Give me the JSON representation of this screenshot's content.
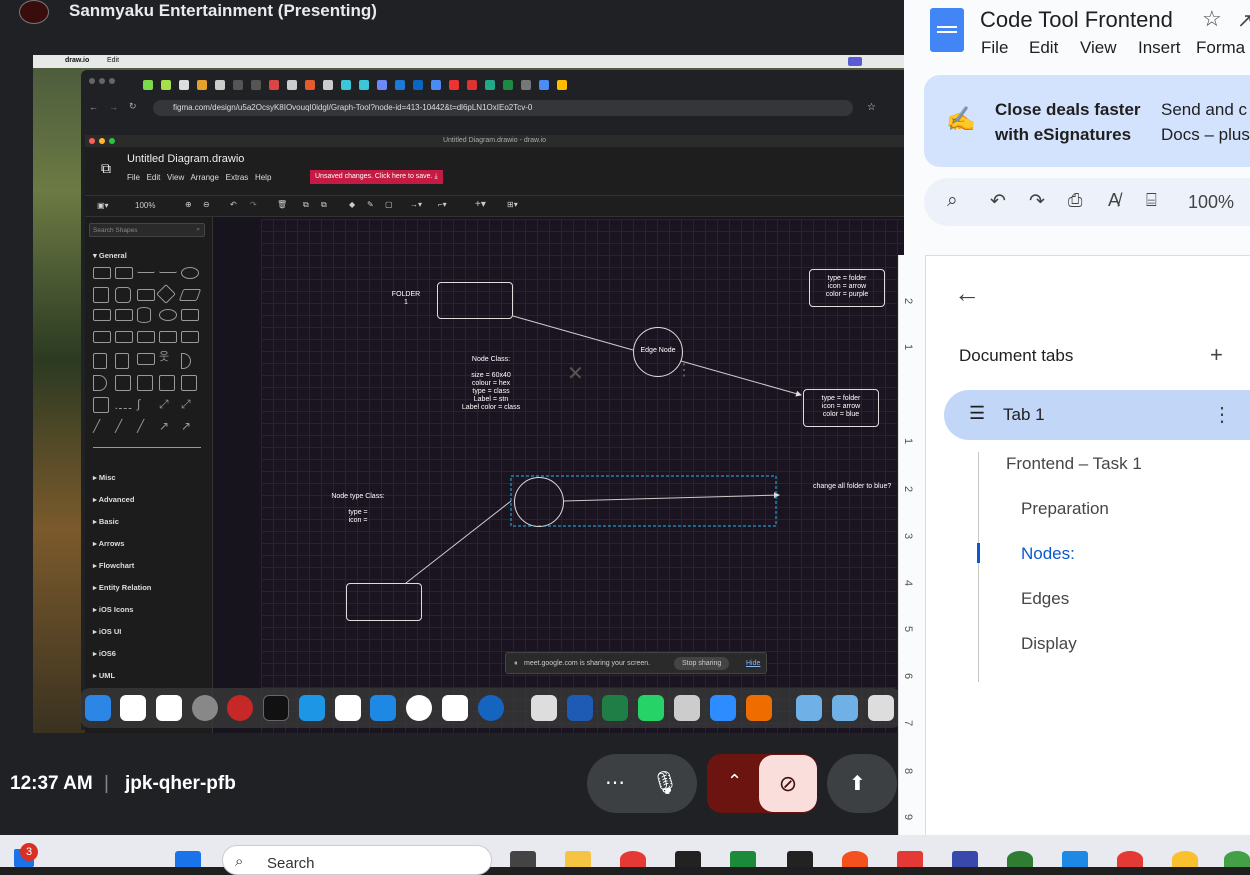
{
  "meet": {
    "presenter": "Sanmyaku Entertainment (Presenting)",
    "time": "12:37 AM",
    "code": "jpk-qher-pfb",
    "separator": "|"
  },
  "mac": {
    "app": "draw.io",
    "menu": "Edit"
  },
  "browser": {
    "url": "figma.com/design/u5a2OcsyK8IOvouqI0idgl/Graph-Tool?node-id=413-10442&t=dl6pLN1OxIEo2Tcv-0"
  },
  "drawio": {
    "window_title": "Untitled Diagram.drawio - draw.io",
    "doc_title": "Untitled Diagram.drawio",
    "menus": [
      "File",
      "Edit",
      "View",
      "Arrange",
      "Extras",
      "Help"
    ],
    "unsaved": "Unsaved changes. Click here to save.",
    "zoom": "100%",
    "search_placeholder": "Search Shapes",
    "sections": [
      "General",
      "Misc",
      "Advanced",
      "Basic",
      "Arrows",
      "Flowchart",
      "Entity Relation",
      "iOS Icons",
      "iOS UI",
      "iOS6",
      "UML"
    ],
    "canvas": {
      "folder_label": "FOLDER\n1",
      "edge_node": "Edge Node",
      "node_class": "Node Class:\n\nsize = 60x40\ncolour = hex\ntype = class\nLabel = stn\nLabel color = class",
      "legend_purple": "type = folder\nicon = arrow\ncolor = purple",
      "legend_blue": "type = folder\nicon = arrow\ncolor = blue",
      "node_type_class": "Node type Class:\n\ntype =\nicon =",
      "question": "change all folder to blue?"
    },
    "share_bar": {
      "text": "meet.google.com is sharing your screen.",
      "stop": "Stop sharing",
      "hide": "Hide"
    }
  },
  "docs": {
    "title": "Code Tool Frontend",
    "menus": [
      "File",
      "Edit",
      "View",
      "Insert",
      "Forma"
    ],
    "banner_title": "Close deals faster with eSignatures",
    "banner_body": "Send and c Docs – plus",
    "zoom": "100%",
    "outline_header": "Document tabs",
    "tab": "Tab 1",
    "items": [
      {
        "label": "Frontend – Task 1",
        "level": 1
      },
      {
        "label": "Preparation",
        "level": 2
      },
      {
        "label": "Nodes:",
        "level": 2,
        "active": true
      },
      {
        "label": "Edges",
        "level": 2
      },
      {
        "label": "Display",
        "level": 2
      }
    ],
    "ruler": [
      "2",
      "1",
      "1",
      "1",
      "2",
      "3",
      "4",
      "5",
      "6",
      "7",
      "8",
      "9"
    ]
  },
  "taskbar": {
    "search": "Search",
    "notif_count": "3"
  },
  "colors": {
    "meet_bg": "#202124",
    "docs_accent": "#0b57d0",
    "unsaved": "#c41a43",
    "selected_tab": "#c2d7f8",
    "end_call": "#6b1410"
  }
}
